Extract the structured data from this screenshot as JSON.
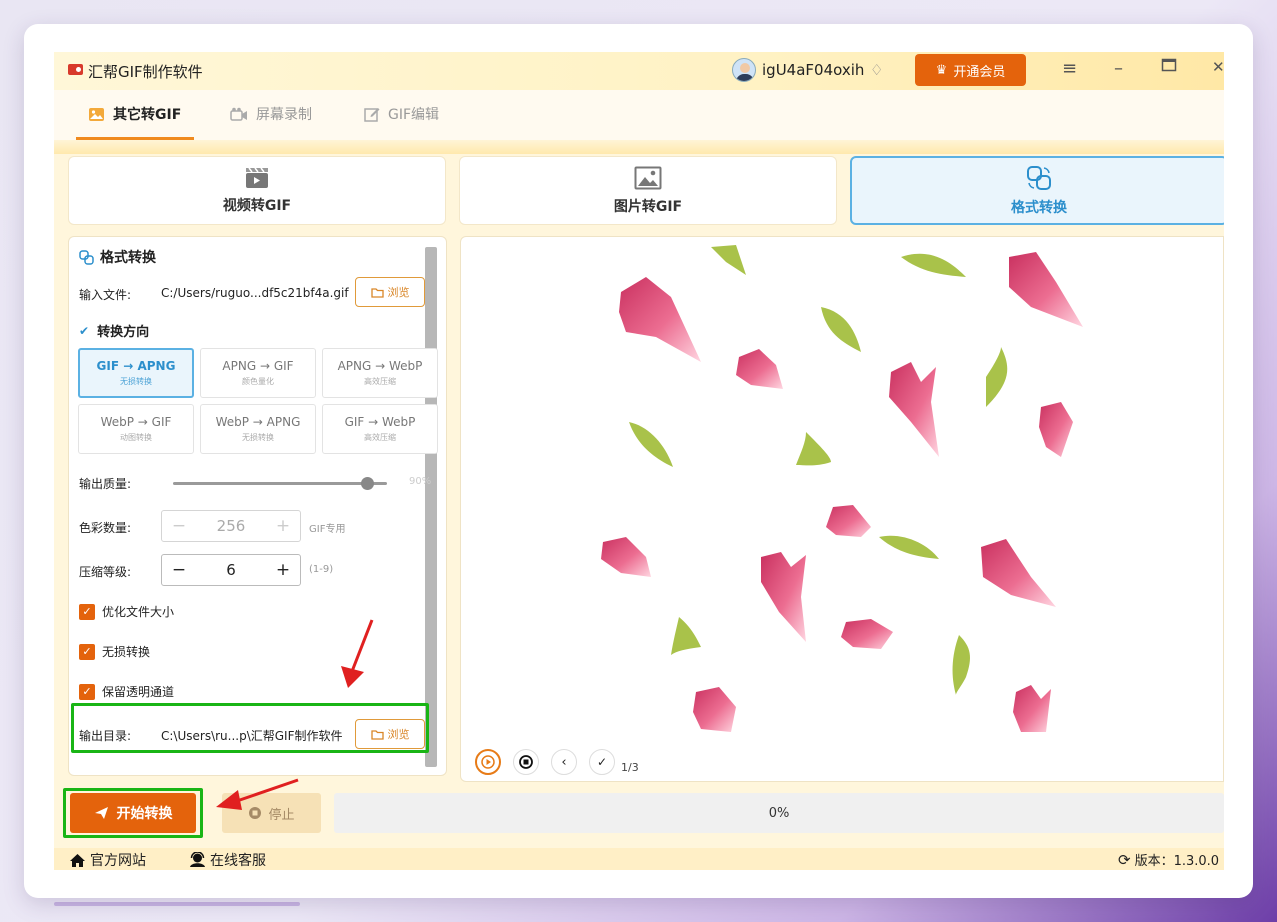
{
  "app": {
    "title": "汇帮GIF制作软件"
  },
  "user": {
    "name": "igU4aF04oxih"
  },
  "vip_button": "开通会员",
  "tabs": [
    {
      "label": "其它转GIF",
      "active": true
    },
    {
      "label": "屏幕录制",
      "active": false
    },
    {
      "label": "GIF编辑",
      "active": false
    }
  ],
  "modes": [
    {
      "label": "视频转GIF",
      "icon": "video-icon"
    },
    {
      "label": "图片转GIF",
      "icon": "image-icon"
    },
    {
      "label": "格式转换",
      "icon": "convert-icon",
      "active": true
    }
  ],
  "panel": {
    "title": "格式转换",
    "input_label": "输入文件:",
    "input_path": "C:/Users/ruguo...df5c21bf4a.gif",
    "browse": "浏览",
    "direction_title": "转换方向",
    "directions": [
      {
        "main": "GIF → APNG",
        "sub": "无损转换",
        "active": true
      },
      {
        "main": "APNG → GIF",
        "sub": "颜色量化"
      },
      {
        "main": "APNG → WebP",
        "sub": "高效压缩"
      },
      {
        "main": "WebP → GIF",
        "sub": "动图转换"
      },
      {
        "main": "WebP → APNG",
        "sub": "无损转换"
      },
      {
        "main": "GIF → WebP",
        "sub": "高效压缩"
      }
    ],
    "quality_label": "输出质量:",
    "quality_value": "90%",
    "quality_fraction": 0.9,
    "colors_label": "色彩数量:",
    "colors_value": "256",
    "colors_hint": "GIF专用",
    "compress_label": "压缩等级:",
    "compress_value": "6",
    "compress_hint": "(1-9)",
    "checkboxes": [
      {
        "label": "优化文件大小",
        "checked": true
      },
      {
        "label": "无损转换",
        "checked": true
      },
      {
        "label": "保留透明通道",
        "checked": true
      }
    ],
    "output_label": "输出目录:",
    "output_path": "C:\\Users\\ru...p\\汇帮GIF制作软件"
  },
  "preview": {
    "page": "1/3"
  },
  "actions": {
    "start": "开始转换",
    "stop": "停止",
    "progress": "0%"
  },
  "footer": {
    "website": "官方网站",
    "support": "在线客服",
    "version": "版本：1.3.0.0"
  },
  "colors": {
    "accent": "#e4630c",
    "highlight_blue": "#5bb1e3",
    "annotation_green": "#19b515",
    "annotation_red": "#e02020"
  }
}
